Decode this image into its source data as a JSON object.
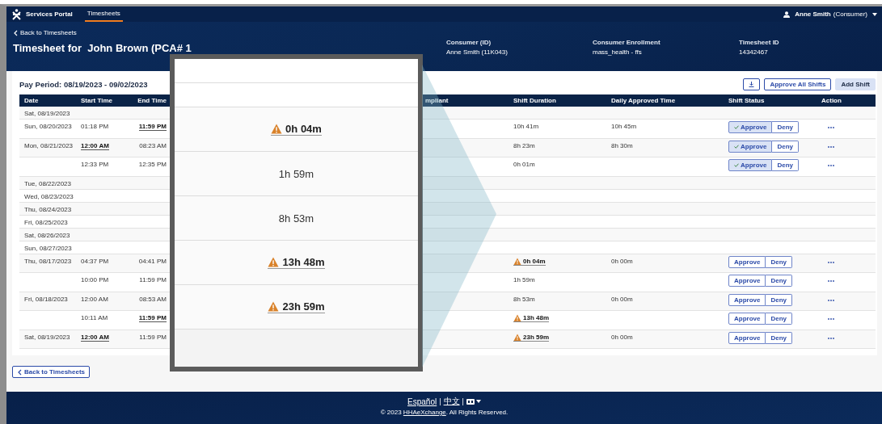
{
  "top_nav": {
    "brand": "Services Portal",
    "tabs": [
      {
        "label": "Timesheets",
        "selected": true
      }
    ],
    "user": {
      "name": "Anne Smith",
      "role": "(Consumer)"
    }
  },
  "header": {
    "back_link": "Back to Timesheets",
    "title": "Timesheet for  John Brown (PCA# 1",
    "fields": [
      {
        "label": "Consumer (ID)",
        "value": "Anne Smith (11K043)"
      },
      {
        "label": "Consumer Enrollment",
        "value": "mass_health - ffs"
      },
      {
        "label": "Timesheet ID",
        "value": "14342467"
      }
    ]
  },
  "pay_period": {
    "title": "Pay Period: 08/19/2023 - 09/02/2023",
    "buttons": [
      {
        "label": "Approve All Shifts",
        "kind": "outline"
      },
      {
        "label": "Add Shift",
        "kind": "filled"
      }
    ]
  },
  "table": {
    "columns": [
      "Date",
      "Start Time",
      "End Time",
      "mpliant",
      "Shift Duration",
      "Daily Approved Time",
      "Shift Status",
      "Action"
    ],
    "rows": [
      {
        "date": "Sat, 08/19/2023"
      },
      {
        "date": "Sun, 08/20/2023",
        "start": {
          "text": "01:18 PM",
          "flagged": false
        },
        "end": {
          "text": "11:59 PM",
          "flagged": true
        },
        "duration": {
          "text": "10h 41m",
          "warning": false
        },
        "daily": "10h 45m",
        "status": {
          "approve": "Approve",
          "deny": "Deny",
          "approved": true
        }
      },
      {
        "date": "Mon, 08/21/2023",
        "start": {
          "text": "12:00 AM",
          "flagged": true
        },
        "end": {
          "text": "08:23 AM",
          "flagged": false
        },
        "duration": {
          "text": "8h 23m",
          "warning": false
        },
        "daily": "8h 30m",
        "status": {
          "approve": "Approve",
          "deny": "Deny",
          "approved": true
        }
      },
      {
        "start": {
          "text": "12:33 PM",
          "flagged": false
        },
        "end": {
          "text": "12:35 PM",
          "flagged": false
        },
        "duration": {
          "text": "0h 01m",
          "warning": false
        },
        "status": {
          "approve": "Approve",
          "deny": "Deny",
          "approved": true
        }
      },
      {
        "date": "Tue, 08/22/2023"
      },
      {
        "date": "Wed, 08/23/2023"
      },
      {
        "date": "Thu, 08/24/2023"
      },
      {
        "date": "Fri, 08/25/2023"
      },
      {
        "date": "Sat, 08/26/2023"
      },
      {
        "date": "Sun, 08/27/2023"
      },
      {
        "date": "Thu, 08/17/2023",
        "start": {
          "text": "04:37 PM",
          "flagged": false
        },
        "end": {
          "text": "04:41 PM",
          "flagged": false
        },
        "duration": {
          "text": "0h 04m",
          "warning": true
        },
        "daily": "0h 00m",
        "status": {
          "approve": "Approve",
          "deny": "Deny",
          "approved": false
        }
      },
      {
        "start": {
          "text": "10:00 PM",
          "flagged": false
        },
        "end": {
          "text": "11:59 PM",
          "flagged": false
        },
        "duration": {
          "text": "1h 59m",
          "warning": false
        },
        "status": {
          "approve": "Approve",
          "deny": "Deny",
          "approved": false
        }
      },
      {
        "date": "Fri, 08/18/2023",
        "start": {
          "text": "12:00 AM",
          "flagged": false
        },
        "end": {
          "text": "08:53 AM",
          "flagged": false
        },
        "duration": {
          "text": "8h 53m",
          "warning": false
        },
        "daily": "0h 00m",
        "status": {
          "approve": "Approve",
          "deny": "Deny",
          "approved": false
        }
      },
      {
        "start": {
          "text": "10:11 AM",
          "flagged": false
        },
        "end": {
          "text": "11:59 PM",
          "flagged": true
        },
        "duration": {
          "text": "13h 48m",
          "warning": true
        },
        "status": {
          "approve": "Approve",
          "deny": "Deny",
          "approved": false
        }
      },
      {
        "date": "Sat, 08/19/2023",
        "start": {
          "text": "12:00 AM",
          "flagged": true
        },
        "end": {
          "text": "11:59 PM",
          "flagged": false
        },
        "duration": {
          "text": "23h 59m",
          "warning": true
        },
        "daily": "0h 00m",
        "status": {
          "approve": "Approve",
          "deny": "Deny",
          "approved": false
        }
      }
    ]
  },
  "magnifier": {
    "rows": [
      {
        "kind": "blank"
      },
      {
        "kind": "blank"
      },
      {
        "kind": "duration",
        "text": "0h 04m",
        "warning": true
      },
      {
        "kind": "duration",
        "text": "1h 59m",
        "warning": false
      },
      {
        "kind": "duration",
        "text": "8h 53m",
        "warning": false
      },
      {
        "kind": "duration",
        "text": "13h 48m",
        "warning": true
      },
      {
        "kind": "duration",
        "text": "23h 59m",
        "warning": true
      }
    ]
  },
  "back_button": "Back to Timesheets",
  "footer": {
    "languages": [
      {
        "label": "Español",
        "separator": "|"
      },
      {
        "label": "中文",
        "separator": "|"
      }
    ],
    "copyright_before": "© 2023 ",
    "copyright_link": "HHAeXchange",
    "copyright_after": ". All Rights Reserved."
  }
}
